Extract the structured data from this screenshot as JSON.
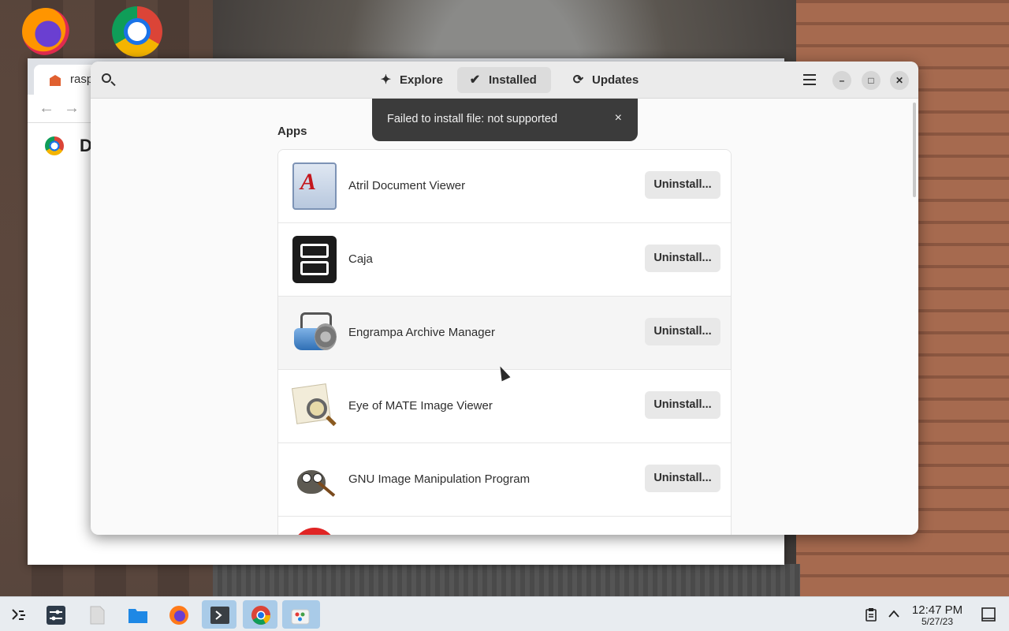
{
  "chrome_window": {
    "tab_title": "raspb",
    "page_heading": "D",
    "back_glyph": "←",
    "forward_glyph": "→"
  },
  "software": {
    "tabs": [
      {
        "label": "Explore",
        "icon": "sparkle-icon",
        "glyph": "✦"
      },
      {
        "label": "Installed",
        "icon": "check-circle-icon",
        "glyph": "✔"
      },
      {
        "label": "Updates",
        "icon": "refresh-icon",
        "glyph": "⟳"
      }
    ],
    "active_tab": "Installed",
    "toast": {
      "message": "Failed to install file: not supported",
      "close_glyph": "×"
    },
    "section_title": "Apps",
    "apps": [
      {
        "name": "Atril Document Viewer",
        "action": "Uninstall..."
      },
      {
        "name": "Caja",
        "action": "Uninstall..."
      },
      {
        "name": "Engrampa Archive Manager",
        "action": "Uninstall..."
      },
      {
        "name": "Eye of MATE Image Viewer",
        "action": "Uninstall..."
      },
      {
        "name": "GNU Image Manipulation Program",
        "action": "Uninstall..."
      }
    ],
    "window_controls": {
      "minimize": "–",
      "maximize": "□",
      "close": "✕"
    }
  },
  "taskbar": {
    "items": [
      "app-launcher-icon",
      "settings-icon",
      "blank-file-icon",
      "folder-icon",
      "firefox-icon",
      "terminal-icon",
      "chrome-icon",
      "software-store-icon"
    ],
    "clock": {
      "time": "12:47 PM",
      "date": "5/27/23"
    }
  },
  "colors": {
    "toast_bg": "#3b3b3b",
    "header_bg": "#ebebeb",
    "active_task": "#a9cbe8"
  }
}
